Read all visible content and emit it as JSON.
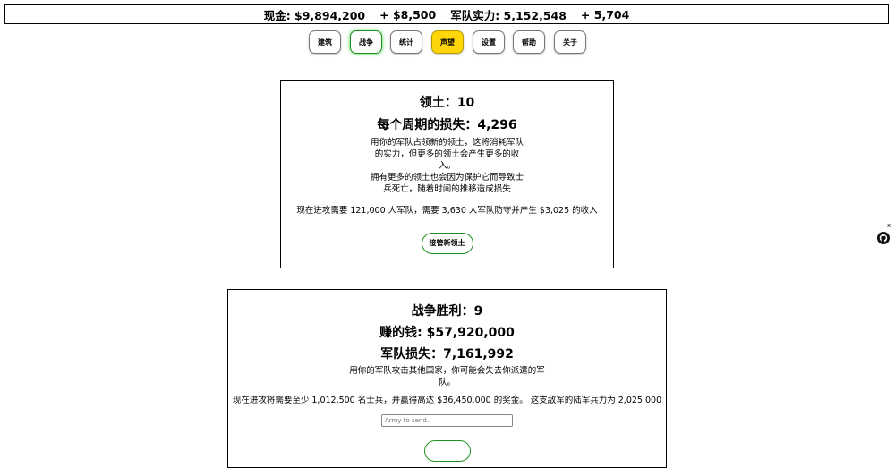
{
  "topbar": {
    "cash_label": "现金: $9,894,200",
    "cash_delta": "+ $8,500",
    "army_label": "军队实力: 5,152,548",
    "army_delta": "+ 5,704"
  },
  "nav": {
    "buildings": "建筑",
    "war": "战争",
    "stats": "统计",
    "reputation": "声望",
    "settings": "设置",
    "help": "帮助",
    "about": "关于"
  },
  "territory": {
    "title": "领土：10",
    "loss": "每个周期的损失：4,296",
    "desc1": "用你的军队占领新的领土，这将消耗军队的实力，但更多的领土会产生更多的收入。",
    "desc2": "拥有更多的领土也会因为保护它而导致士兵死亡，随着时间的推移造成损失",
    "requirement": "现在进攻需要 121,000 人军队，需要 3,630 人军队防守并产生 $3,025 的收入",
    "button": "接管新领土"
  },
  "war": {
    "wins": "战争胜利：9",
    "money": "赚的钱: $57,920,000",
    "losses": "军队损失：7,161,992",
    "desc": "用你的军队攻击其他国家，你可能会失去你派遣的军队。",
    "requirement": "现在进攻将需要至少 1,012,500 名士兵，并赢得高达 $36,450,000 的奖金。 这支敌军的陆军兵力为 2,025,000",
    "input_placeholder": "Army to send.."
  },
  "corner": {
    "close": "x",
    "icon": "github-icon"
  }
}
